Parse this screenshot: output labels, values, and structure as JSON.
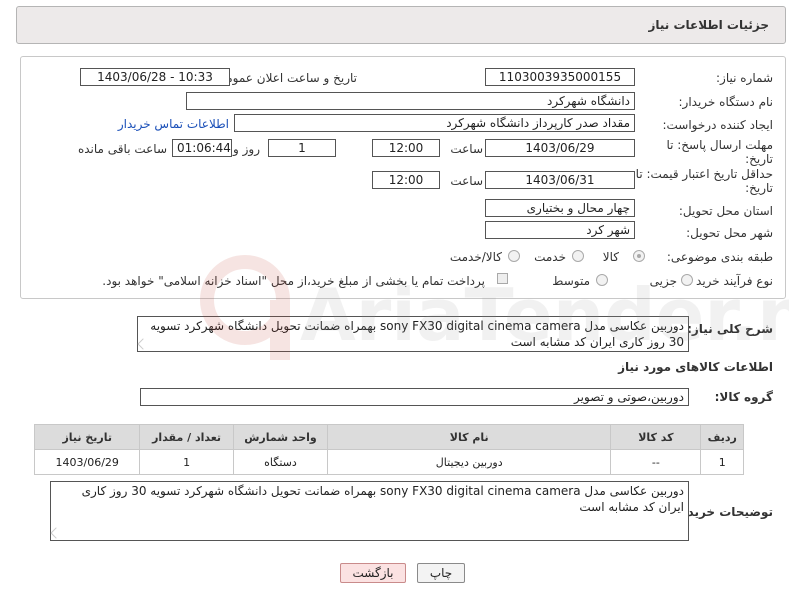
{
  "header": {
    "title": "جزئیات اطلاعات نیاز"
  },
  "form": {
    "need_number_label": "شماره نیاز:",
    "need_number": "1103003935000155",
    "announce_label": "تاریخ و ساعت اعلان عمومی:",
    "announce_value": "1403/06/28 - 10:33",
    "buyer_org_label": "نام دستگاه خریدار:",
    "buyer_org": "دانشگاه شهرکرد",
    "requester_label": "ایجاد کننده درخواست:",
    "requester": "مقداد صدر کارپرداز دانشگاه شهرکرد",
    "buyer_contact_link": "اطلاعات تماس خریدار",
    "deadline_label_1": "مهلت ارسال پاسخ: تا",
    "deadline_label_2": "تاریخ:",
    "deadline_date": "1403/06/29",
    "time_label": "ساعت",
    "deadline_time": "12:00",
    "days_value": "1",
    "days_label": "روز و",
    "remaining_time": "01:06:44",
    "remaining_label": "ساعت باقی مانده",
    "validity_label_1": "حداقل تاریخ اعتبار قیمت: تا",
    "validity_label_2": "تاریخ:",
    "validity_date": "1403/06/31",
    "validity_time": "12:00",
    "province_label": "استان محل تحویل:",
    "province": "چهار محال و بختیاری",
    "city_label": "شهر محل تحویل:",
    "city": "شهر کرد",
    "category_label": "طبقه بندی موضوعی:",
    "category_options": [
      "کالا",
      "خدمت",
      "کالا/خدمت"
    ],
    "process_label": "نوع فرآیند خرید :",
    "process_options": [
      "جزیی",
      "متوسط"
    ],
    "payment_note": "پرداخت تمام یا بخشی از مبلغ خرید،از محل \"اسناد خزانه اسلامی\" خواهد بود."
  },
  "description": {
    "label": "شرح کلی نیاز:",
    "text": "دوربین عکاسی مدل sony FX30 digital cinema camera بهمراه ضمانت تحویل دانشگاه شهرکرد تسویه 30 روز کاری ایران کد مشابه است"
  },
  "goods": {
    "section_title": "اطلاعات کالاهای مورد نیاز",
    "group_label": "گروه کالا:",
    "group_value": "دوربین،صوتی و تصویر",
    "columns": [
      "ردیف",
      "کد کالا",
      "نام کالا",
      "واحد شمارش",
      "تعداد / مقدار",
      "تاریخ نیاز"
    ],
    "rows": [
      [
        "1",
        "--",
        "دوربین دیجیتال",
        "دستگاه",
        "1",
        "1403/06/29"
      ]
    ]
  },
  "buyer_notes": {
    "label": "توضیحات خریدار:",
    "text": "دوربین عکاسی مدل sony FX30 digital cinema camera بهمراه ضمانت تحویل دانشگاه شهرکرد تسویه 30 روز کاری ایران کد مشابه است"
  },
  "buttons": {
    "print": "چاپ",
    "back": "بازگشت"
  },
  "watermark": {
    "text": "AriaTender.neT"
  },
  "colors": {
    "link": "#1a4fb8",
    "header_bg": "#edeaea",
    "back_button": "#fbe2e2"
  }
}
